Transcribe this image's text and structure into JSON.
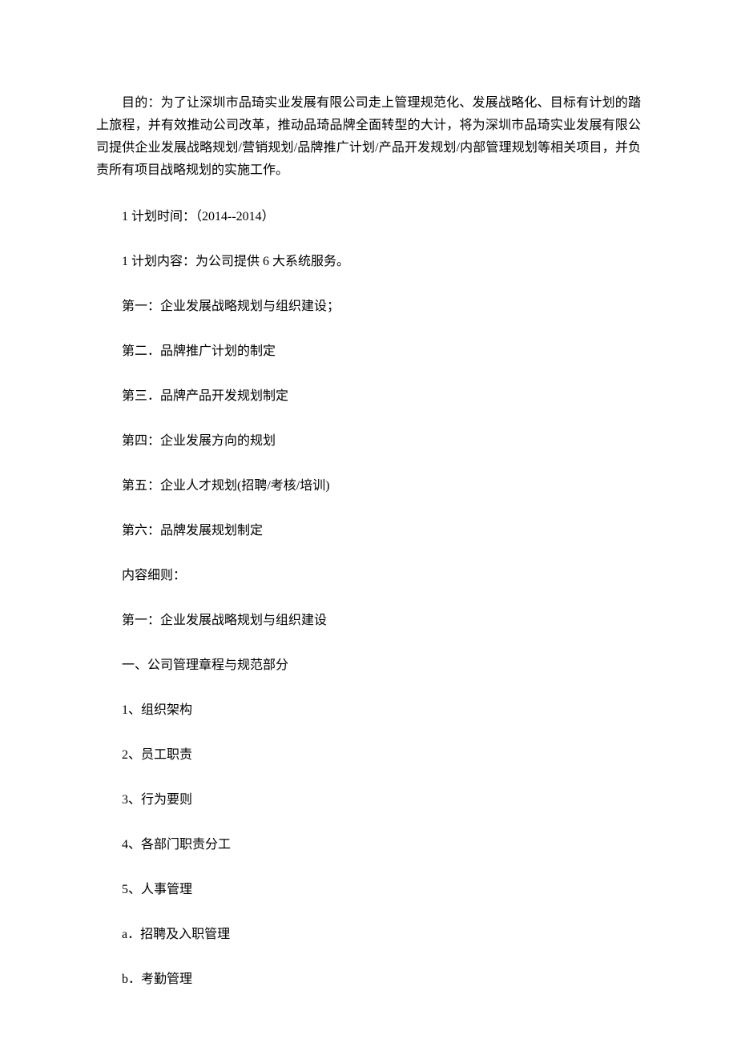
{
  "intro": "目的：为了让深圳市品琦实业发展有限公司走上管理规范化、发展战略化、目标有计划的踏上旅程，并有效推动公司改革，推动品琦品牌全面转型的大计，将为深圳市品琦实业发展有限公司提供企业发展战略规划/营销规划/品牌推广计划/产品开发规划/内部管理规划等相关项目，并负责所有项目战略规划的实施工作。",
  "lines": [
    "1 计划时间：（2014--2014）",
    "1 计划内容：为公司提供 6 大系统服务。",
    "第一：企业发展战略规划与组织建设；",
    "第二．品牌推广计划的制定",
    "第三．品牌产品开发规划制定",
    "第四：企业发展方向的规划",
    "第五：企业人才规划(招聘/考核/培训)",
    "第六：品牌发展规划制定",
    "内容细则：",
    "第一：企业发展战略规划与组织建设",
    "一、公司管理章程与规范部分",
    "1、组织架构",
    "2、员工职责",
    "3、行为要则",
    "4、各部门职责分工",
    "5、人事管理",
    "a．招聘及入职管理",
    "b．考勤管理"
  ]
}
